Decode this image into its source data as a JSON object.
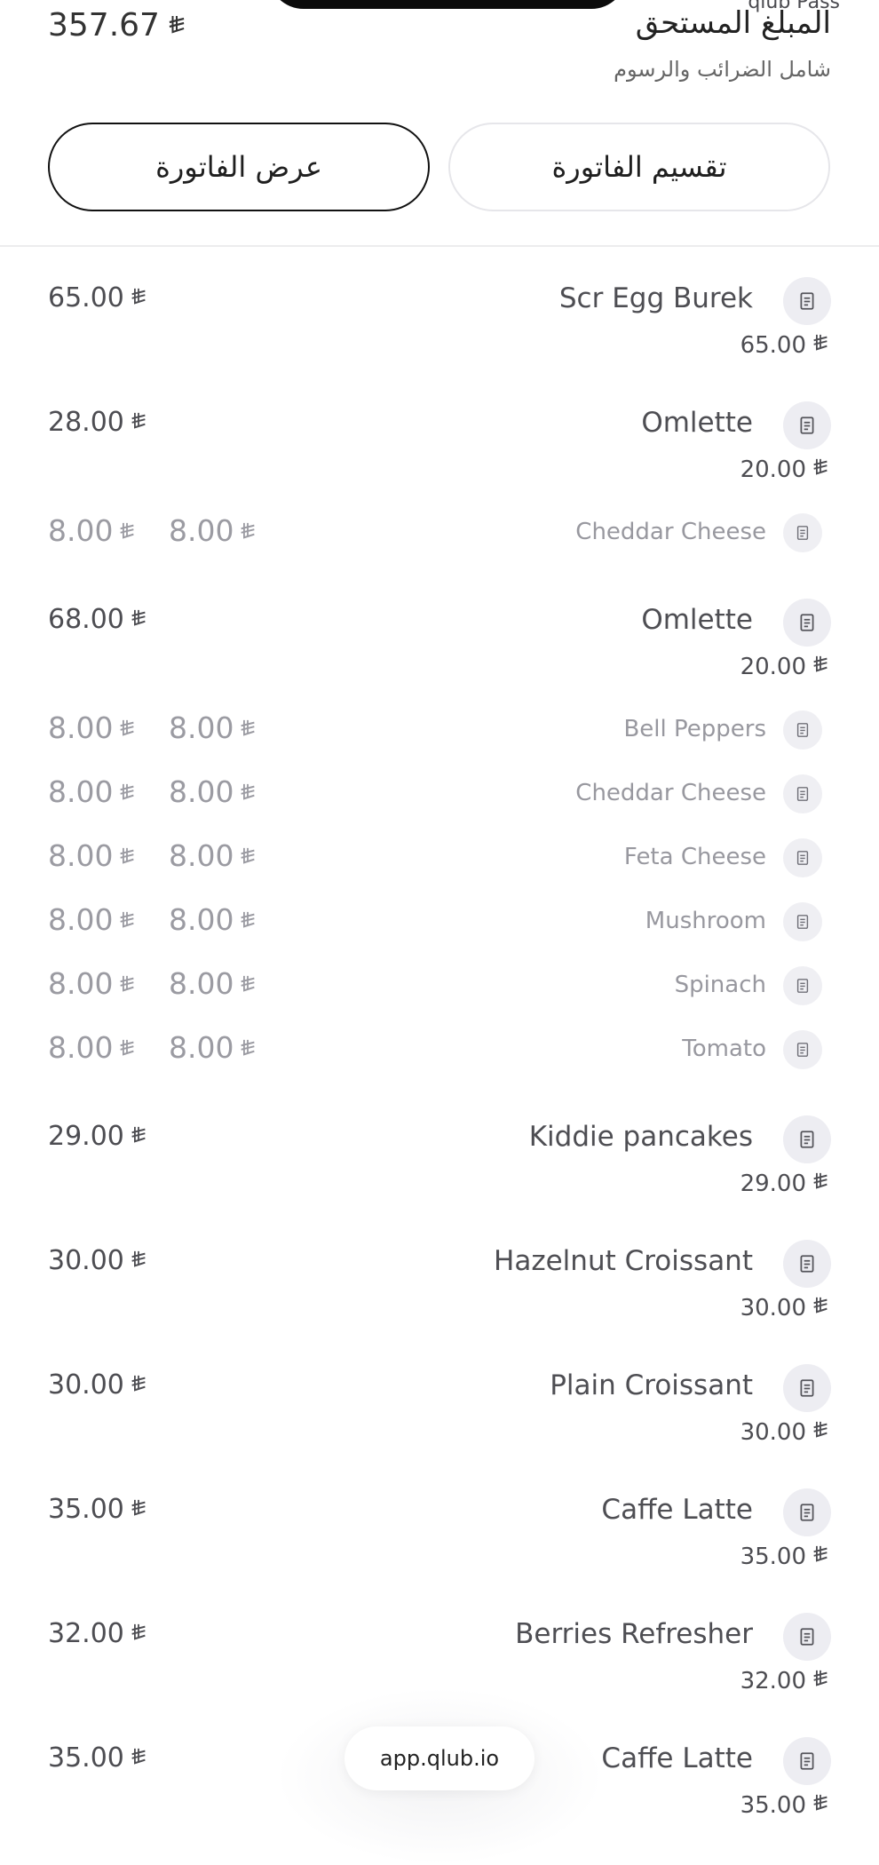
{
  "header": {
    "top_label": "qlub Pass",
    "total_amount": "357.67",
    "due_title": "المبلغ المستحق",
    "due_subtitle": "شامل الضرائب والرسوم",
    "view_bill_label": "عرض الفاتورة",
    "split_bill_label": "تقسيم الفاتورة"
  },
  "currency_symbol": "⃁",
  "items": [
    {
      "name": "Scr Egg Burek",
      "price": "65.00",
      "unit_price": "65.00",
      "modifiers": []
    },
    {
      "name": "Omlette",
      "price": "28.00",
      "unit_price": "20.00",
      "modifiers": [
        {
          "name": "Cheddar Cheese",
          "total": "8.00",
          "unit": "8.00"
        }
      ]
    },
    {
      "name": "Omlette",
      "price": "68.00",
      "unit_price": "20.00",
      "modifiers": [
        {
          "name": "Bell Peppers",
          "total": "8.00",
          "unit": "8.00"
        },
        {
          "name": "Cheddar Cheese",
          "total": "8.00",
          "unit": "8.00"
        },
        {
          "name": "Feta Cheese",
          "total": "8.00",
          "unit": "8.00"
        },
        {
          "name": "Mushroom",
          "total": "8.00",
          "unit": "8.00"
        },
        {
          "name": "Spinach",
          "total": "8.00",
          "unit": "8.00"
        },
        {
          "name": "Tomato",
          "total": "8.00",
          "unit": "8.00"
        }
      ]
    },
    {
      "name": "Kiddie pancakes",
      "price": "29.00",
      "unit_price": "29.00",
      "modifiers": []
    },
    {
      "name": "Hazelnut Croissant",
      "price": "30.00",
      "unit_price": "30.00",
      "modifiers": []
    },
    {
      "name": "Plain Croissant",
      "price": "30.00",
      "unit_price": "30.00",
      "modifiers": []
    },
    {
      "name": "Caffe Latte",
      "price": "35.00",
      "unit_price": "35.00",
      "modifiers": []
    },
    {
      "name": "Berries Refresher",
      "price": "32.00",
      "unit_price": "32.00",
      "modifiers": []
    },
    {
      "name": "Caffe Latte",
      "price": "35.00",
      "unit_price": "35.00",
      "modifiers": []
    }
  ],
  "footer": {
    "url": "app.qlub.io"
  }
}
